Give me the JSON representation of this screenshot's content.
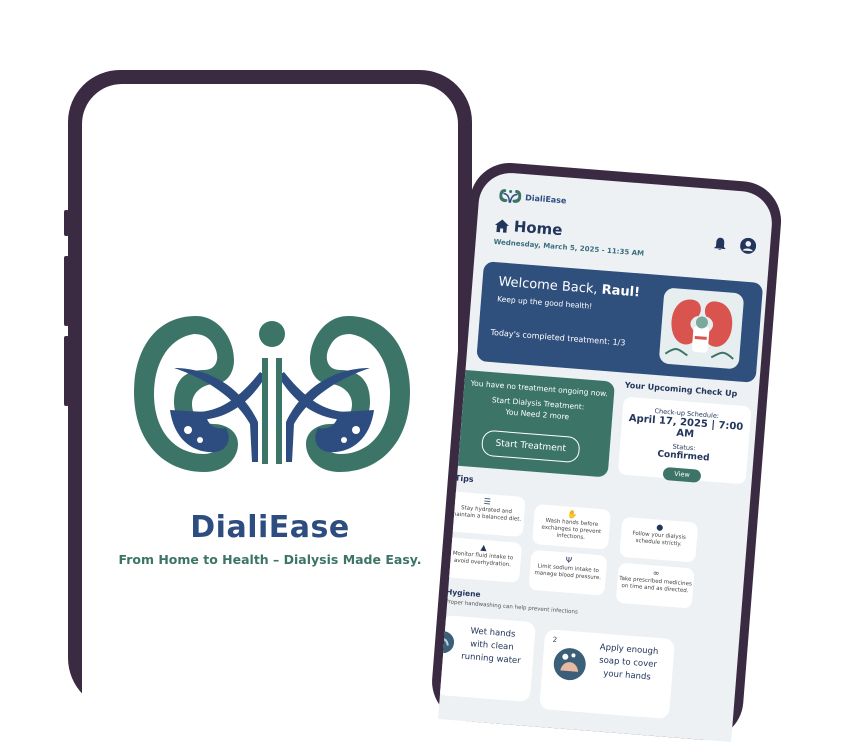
{
  "splash": {
    "app_name": "DialiEase",
    "tagline": "From Home to Health – Dialysis Made Easy."
  },
  "home": {
    "brand": "DialiEase",
    "title": "Home",
    "date": "Wednesday, March 5, 2025 - 11:35 AM",
    "welcome": {
      "greeting": "Welcome Back, ",
      "name": "Raul!",
      "subtitle": "Keep up the good health!",
      "completed": "Today's completed treatment: 1/3"
    },
    "no_treatment": {
      "line1": "You have no treatment ongoing now.",
      "line2": "Start Dialysis Treatment:",
      "line3": "You Need 2 more",
      "button": "Start Treatment"
    },
    "checkup": {
      "title": "Your Upcoming Check Up",
      "schedule_label": "Check-up Schedule:",
      "schedule_value": "April 17, 2025 | 7:00 AM",
      "status_label": "Status:",
      "status_value": "Confirmed",
      "view_button": "View"
    },
    "tips_title": "Tips",
    "tips": [
      {
        "icon": "list-icon",
        "text": "Stay hydrated and maintain a balanced diet."
      },
      {
        "icon": "hands-icon",
        "text": "Wash hands before exchanges to prevent infections."
      },
      {
        "icon": "clock-icon",
        "text": "Follow your dialysis schedule strictly."
      },
      {
        "icon": "drop-icon",
        "text": "Monitor fluid intake to avoid overhydration."
      },
      {
        "icon": "cutlery-icon",
        "text": "Limit sodium intake to manage blood pressure."
      },
      {
        "icon": "pills-icon",
        "text": "Take prescribed medicines on time and as directed."
      }
    ],
    "hygiene_title": "Hygiene",
    "hygiene_sub": "Proper handwashing can help prevent infections",
    "hygiene_steps": [
      {
        "text": "Wet hands with clean running water"
      },
      {
        "num": "2",
        "text": "Apply enough soap to cover your hands"
      }
    ],
    "colors": {
      "navy": "#2f4f7d",
      "teal": "#3c7568",
      "frame": "#3a2b42"
    }
  }
}
